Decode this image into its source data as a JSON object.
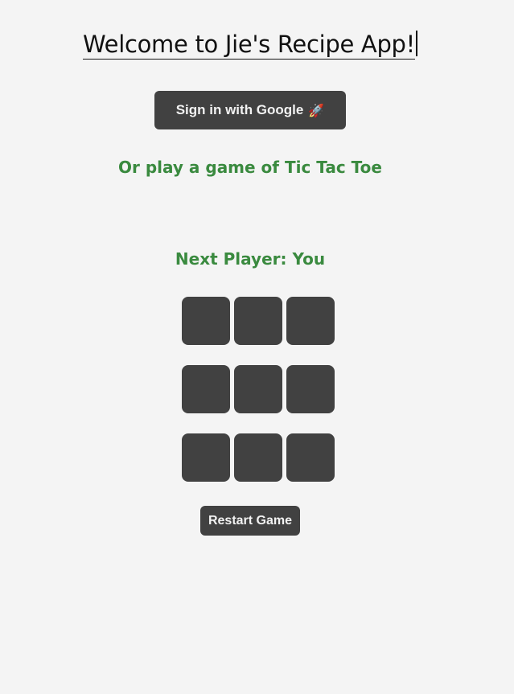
{
  "header": {
    "title": "Welcome to Jie's Recipe App!"
  },
  "auth": {
    "google_button_label": "Sign in with Google",
    "google_button_icon": "rocket-icon",
    "google_button_emoji": "🚀"
  },
  "game": {
    "prompt": "Or play a game of Tic Tac Toe",
    "status": "Next Player: You",
    "board": [
      [
        "",
        "",
        ""
      ],
      [
        "",
        "",
        ""
      ],
      [
        "",
        "",
        ""
      ]
    ],
    "restart_label": "Restart Game"
  },
  "colors": {
    "background": "#f4f4f4",
    "button": "#414141",
    "accent_green": "#3a8a3f"
  }
}
